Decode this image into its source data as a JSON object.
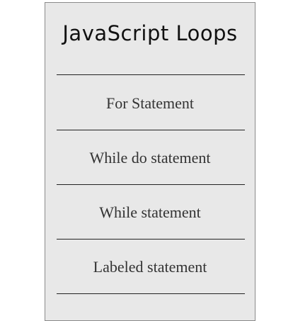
{
  "sidebar": {
    "title": "JavaScript Loops",
    "items": [
      {
        "label": "For Statement"
      },
      {
        "label": "While do statement"
      },
      {
        "label": "While statement"
      },
      {
        "label": "Labeled statement"
      }
    ]
  },
  "colors": {
    "panel_background": "#e8e8e8",
    "panel_border": "#8a8a8a",
    "divider": "#222222",
    "item_text": "#333333",
    "title_text": "#111111"
  }
}
